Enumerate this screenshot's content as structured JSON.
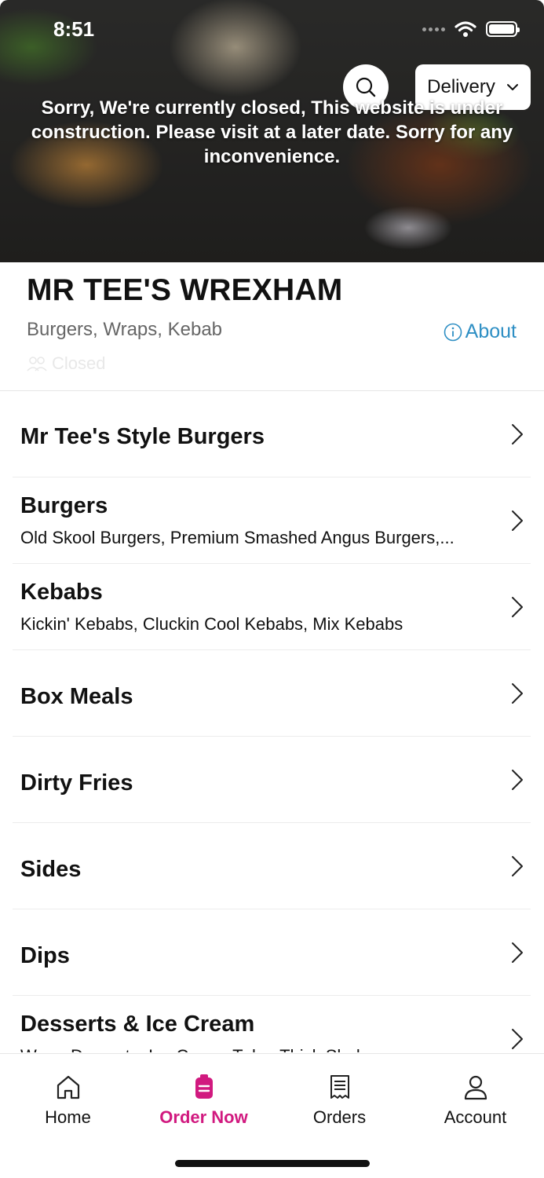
{
  "status_bar": {
    "time": "8:51"
  },
  "hero": {
    "closed_message": "Sorry, We're currently closed, This website is under construction. Please visit at a later date. Sorry for any inconvenience.",
    "delivery_label": "Delivery"
  },
  "restaurant": {
    "name": "MR TEE'S WREXHAM",
    "cuisine": "Burgers, Wraps, Kebab",
    "about_label": "About",
    "status": "Closed"
  },
  "categories": [
    {
      "title": "Mr Tee's Style Burgers",
      "subtitle": ""
    },
    {
      "title": "Burgers",
      "subtitle": "Old Skool Burgers, Premium Smashed Angus Burgers,..."
    },
    {
      "title": "Kebabs",
      "subtitle": "Kickin' Kebabs, Cluckin Cool Kebabs, Mix Kebabs"
    },
    {
      "title": "Box Meals",
      "subtitle": ""
    },
    {
      "title": "Dirty Fries",
      "subtitle": ""
    },
    {
      "title": "Sides",
      "subtitle": ""
    },
    {
      "title": "Dips",
      "subtitle": ""
    },
    {
      "title": "Desserts & Ice Cream",
      "subtitle": "Warm Desserts, Ice Cream Tubs, Thick Shakes"
    }
  ],
  "bottom_nav": {
    "home": "Home",
    "order_now": "Order Now",
    "orders": "Orders",
    "account": "Account"
  },
  "colors": {
    "accent": "#d1197f",
    "link": "#2e8fc4"
  }
}
